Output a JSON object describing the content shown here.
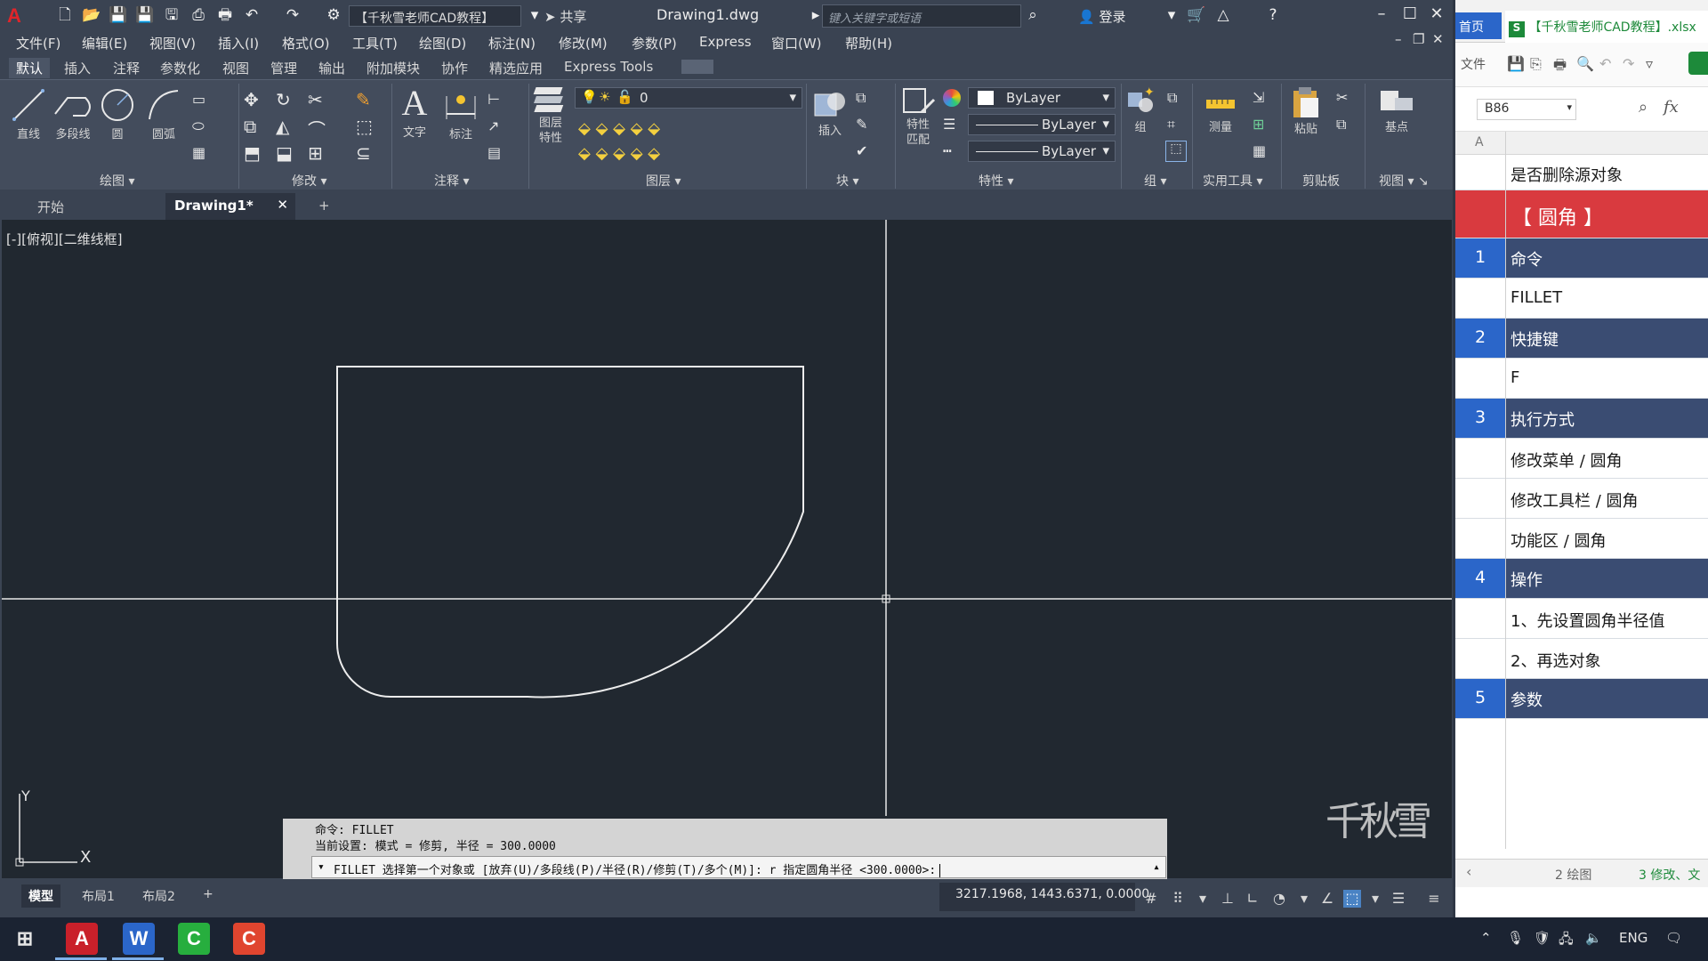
{
  "cad": {
    "workspace": "【千秋雪老师CAD教程】",
    "share_label": "共享",
    "doc_title": "Drawing1.dwg",
    "search_placeholder": "键入关键字或短语",
    "login_label": "登录",
    "menu": [
      "文件(F)",
      "编辑(E)",
      "视图(V)",
      "插入(I)",
      "格式(O)",
      "工具(T)",
      "绘图(D)",
      "标注(N)",
      "修改(M)",
      "参数(P)",
      "Express",
      "窗口(W)",
      "帮助(H)"
    ],
    "ribbon_tabs": [
      "默认",
      "插入",
      "注释",
      "参数化",
      "视图",
      "管理",
      "输出",
      "附加模块",
      "协作",
      "精选应用",
      "Express Tools"
    ],
    "tools": {
      "line": "直线",
      "polyline": "多段线",
      "circle": "圆",
      "arc": "圆弧",
      "text": "文字",
      "dimension": "标注",
      "layer_props_1": "图层",
      "layer_props_2": "特性",
      "insert": "插入",
      "match_1": "特性",
      "match_2": "匹配",
      "group": "组",
      "measure": "测量",
      "paste": "粘贴",
      "base": "基点"
    },
    "groups": [
      "绘图",
      "修改",
      "注释",
      "图层",
      "块",
      "特性",
      "组",
      "实用工具",
      "剪贴板",
      "视图"
    ],
    "layer_value": "0",
    "color_value": "ByLayer",
    "linetype_value": "ByLayer",
    "lineweight_value": "ByLayer",
    "doc_tabs": [
      "开始",
      "Drawing1*"
    ],
    "view_label": "[-][俯视][二维线框]",
    "ucs_y": "Y",
    "ucs_x": "X",
    "watermark": "千秋雪",
    "cmd_history_1": "命令:  FILLET",
    "cmd_history_2": "当前设置: 模式 = 修剪, 半径 = 300.0000",
    "cmd_prompt": "FILLET 选择第一个对象或 [放弃(U)/多段线(P)/半径(R)/修剪(T)/多个(M)]: r 指定圆角半径 <300.0000>:",
    "layout_tabs": [
      "模型",
      "布局1",
      "布局2"
    ],
    "coords": "3217.1968, 1443.6371, 0.0000"
  },
  "excel": {
    "home_tab": "首页",
    "file_tab": "【千秋雪老师CAD教程】.xlsx",
    "file_menu": "文件",
    "name_box": "B86",
    "fx": "fx",
    "col_a": "A",
    "rows": [
      {
        "num": "",
        "text": "是否删除源对象",
        "kind": "plain"
      },
      {
        "num": "",
        "text": "【 圆角 】",
        "kind": "title"
      },
      {
        "num": "1",
        "text": "命令",
        "kind": "header"
      },
      {
        "num": "",
        "text": "FILLET",
        "kind": "plain"
      },
      {
        "num": "2",
        "text": "快捷键",
        "kind": "header"
      },
      {
        "num": "",
        "text": "F",
        "kind": "plain"
      },
      {
        "num": "3",
        "text": "执行方式",
        "kind": "header"
      },
      {
        "num": "",
        "text": "修改菜单 / 圆角",
        "kind": "plain"
      },
      {
        "num": "",
        "text": "修改工具栏 / 圆角",
        "kind": "plain"
      },
      {
        "num": "",
        "text": "功能区 / 圆角",
        "kind": "plain"
      },
      {
        "num": "4",
        "text": "操作",
        "kind": "header"
      },
      {
        "num": "",
        "text": "1、先设置圆角半径值",
        "kind": "plain"
      },
      {
        "num": "",
        "text": "2、再选对象",
        "kind": "plain"
      },
      {
        "num": "5",
        "text": "参数",
        "kind": "header"
      }
    ],
    "sheet_tabs": [
      "2 绘图",
      "3 修改、文"
    ]
  },
  "taskbar": {
    "lang": "ENG"
  },
  "colors": {
    "cad_bg": "#212830",
    "title_red": "#d93a3f",
    "header_blue": "#3a4c72"
  }
}
